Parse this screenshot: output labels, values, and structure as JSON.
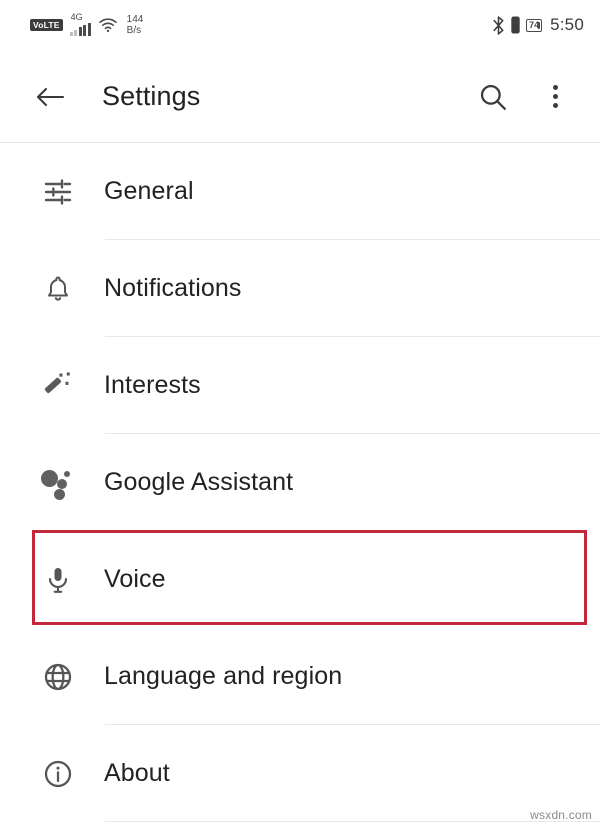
{
  "status_bar": {
    "volte_badge": "VoLTE",
    "network_type": "4G",
    "signal_icon": "signal-bars-icon",
    "wifi_icon": "wifi-icon",
    "data_speed_value": "144",
    "data_speed_unit": "B/s",
    "bluetooth_icon": "bluetooth-icon",
    "vibrate_icon": "vibrate-icon",
    "battery_level": "74",
    "time": "5:50"
  },
  "app_bar": {
    "back_icon": "back-arrow-icon",
    "title": "Settings",
    "search_icon": "search-icon",
    "overflow_icon": "overflow-menu-icon"
  },
  "settings_list": {
    "items": [
      {
        "label": "General",
        "icon": "tune-sliders-icon",
        "highlighted": false
      },
      {
        "label": "Notifications",
        "icon": "bell-icon",
        "highlighted": false
      },
      {
        "label": "Interests",
        "icon": "magic-wand-icon",
        "highlighted": false
      },
      {
        "label": "Google Assistant",
        "icon": "google-assistant-icon",
        "highlighted": false
      },
      {
        "label": "Voice",
        "icon": "microphone-icon",
        "highlighted": true
      },
      {
        "label": "Language and region",
        "icon": "globe-icon",
        "highlighted": false
      },
      {
        "label": "About",
        "icon": "info-circle-icon",
        "highlighted": false
      }
    ]
  },
  "annotation": {
    "highlight_color": "#c2283a",
    "target_label": "Voice"
  },
  "watermark": {
    "text": "wsxdn.com"
  }
}
